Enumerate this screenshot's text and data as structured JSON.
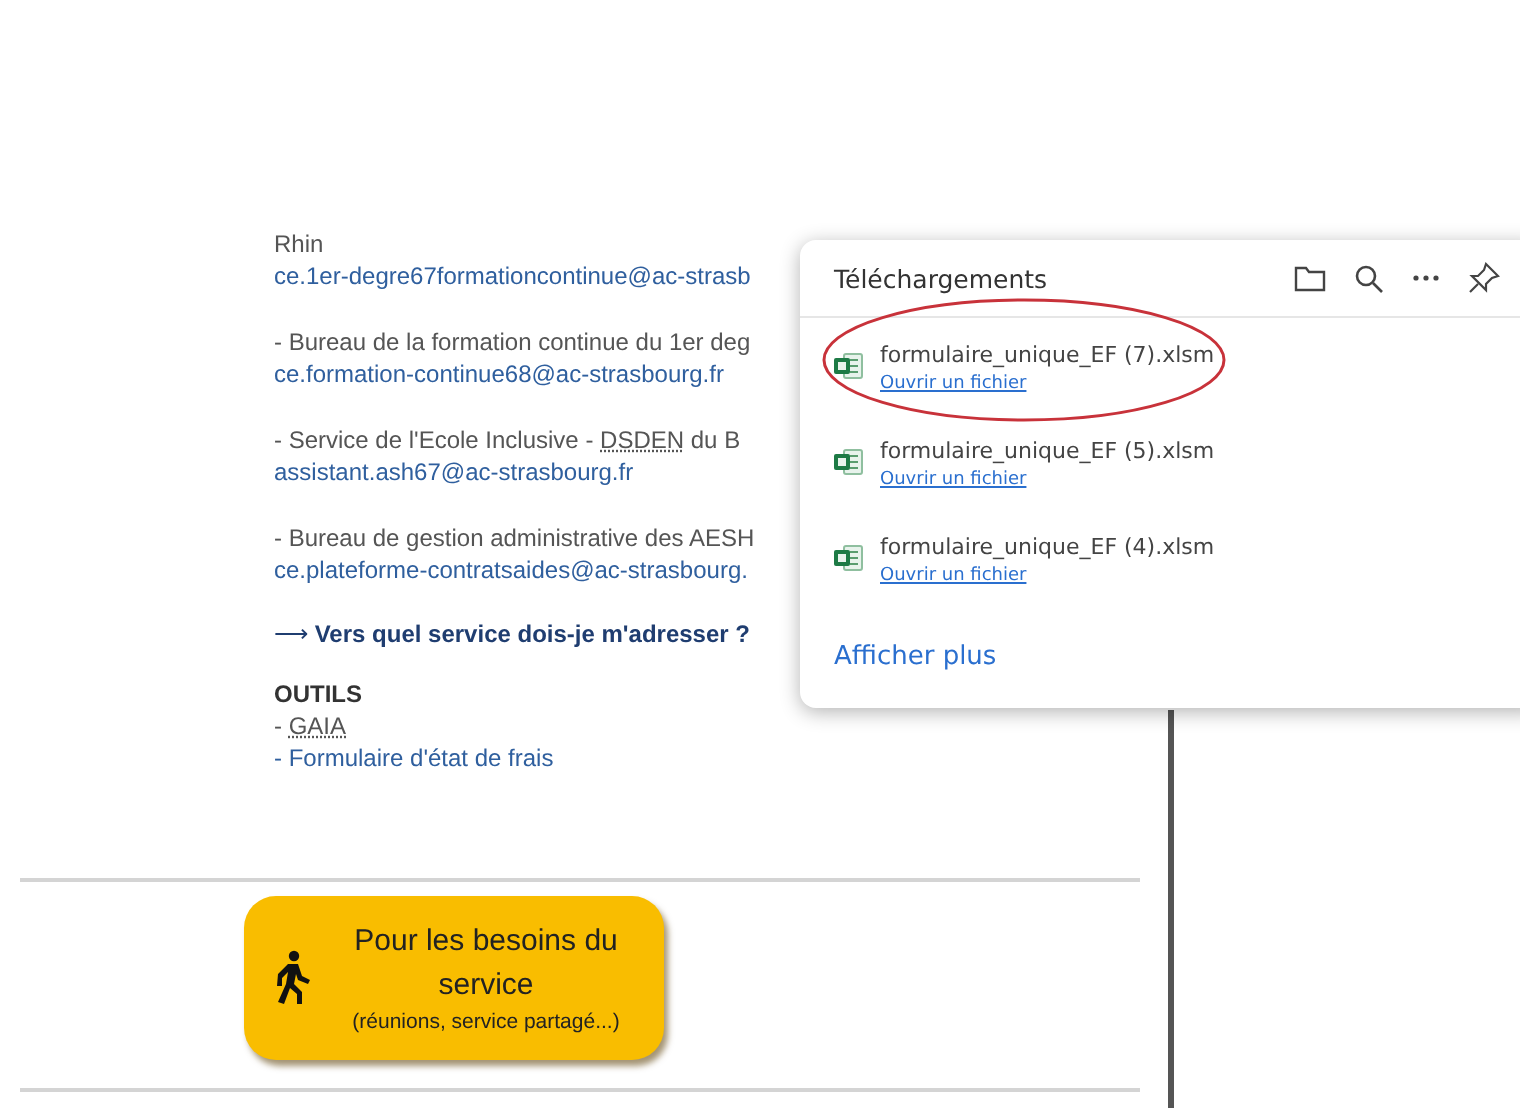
{
  "contacts": [
    {
      "parts": [
        {
          "text": "Rhin"
        }
      ],
      "email": "ce.1er-degre67formationcontinue@ac-strasb"
    },
    {
      "parts": [
        {
          "text": "- Bureau de la formation continue du 1er deg"
        }
      ],
      "email": "ce.formation-continue68@ac-strasbourg.fr"
    },
    {
      "parts": [
        {
          "text": "- Service de l'Ecole Inclusive - "
        },
        {
          "text": "DSDEN",
          "kind": "abbr"
        },
        {
          "text": " du B"
        }
      ],
      "email": "assistant.ash67@ac-strasbourg.fr"
    },
    {
      "parts": [
        {
          "text": "- Bureau de gestion administrative des AESH"
        }
      ],
      "email": "ce.plateforme-contratsaides@ac-strasbourg."
    }
  ],
  "service_link": "⟶ **Vers quel service dois-je m'adresser ?**",
  "tools": {
    "heading": "OUTILS",
    "items": [
      {
        "dash": "- ",
        "label": "GAIA",
        "kind": "abbr"
      },
      {
        "dash": "- ",
        "label": "Formulaire d'état de frais",
        "kind": "link"
      }
    ]
  },
  "service_button": {
    "title": "Pour les besoins du service",
    "subtitle": "(réunions, service partagé...)"
  },
  "downloads": {
    "title": "Téléchargements",
    "items": [
      {
        "file": "formulaire_unique_EF (7).xlsm",
        "action": "Ouvrir un fichier",
        "circled": true
      },
      {
        "file": "formulaire_unique_EF (5).xlsm",
        "action": "Ouvrir un fichier",
        "circled": false
      },
      {
        "file": "formulaire_unique_EF (4).xlsm",
        "action": "Ouvrir un fichier",
        "circled": false
      }
    ],
    "more": "Afficher plus"
  }
}
